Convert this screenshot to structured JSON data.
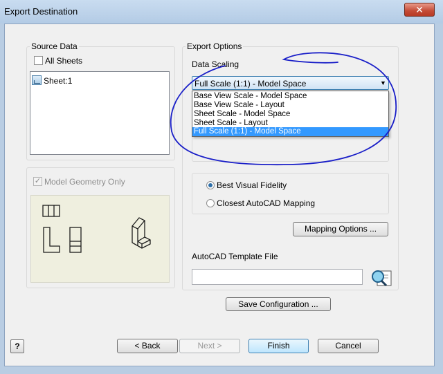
{
  "window": {
    "title": "Export Destination",
    "close_glyph": "✕"
  },
  "source_data": {
    "group_title": "Source Data",
    "all_sheets_label": "All Sheets",
    "all_sheets_checked": false,
    "sheets": [
      "Sheet:1"
    ]
  },
  "model_geometry": {
    "label": "Model Geometry Only",
    "checked": true,
    "enabled": false
  },
  "export_options": {
    "group_title": "Export Options",
    "data_scaling_label": "Data Scaling",
    "selected_scale": "Full Scale (1:1) - Model Space",
    "scale_options": [
      "Base View Scale - Model Space",
      "Base View Scale - Layout",
      "Sheet Scale - Model Space",
      "Sheet Scale - Layout",
      "Full Scale (1:1) - Model Space"
    ],
    "highlighted_option_index": 4,
    "fidelity_options": [
      "Best Visual Fidelity",
      "Closest AutoCAD Mapping"
    ],
    "fidelity_selected_index": 0,
    "mapping_button": "Mapping Options ...",
    "template_label": "AutoCAD Template File",
    "template_value": ""
  },
  "footer": {
    "help_glyph": "?",
    "save_config": "Save Configuration ...",
    "back": "< Back",
    "next": "Next >",
    "finish": "Finish",
    "cancel": "Cancel"
  },
  "icons": {
    "sheet": "sheet-icon",
    "browse": "browse-template-icon",
    "close": "close-icon",
    "help": "help-icon"
  },
  "colors": {
    "highlight": "#3399ff",
    "annotation": "#1a1fc8",
    "title_bar": "#c9dcf0"
  }
}
